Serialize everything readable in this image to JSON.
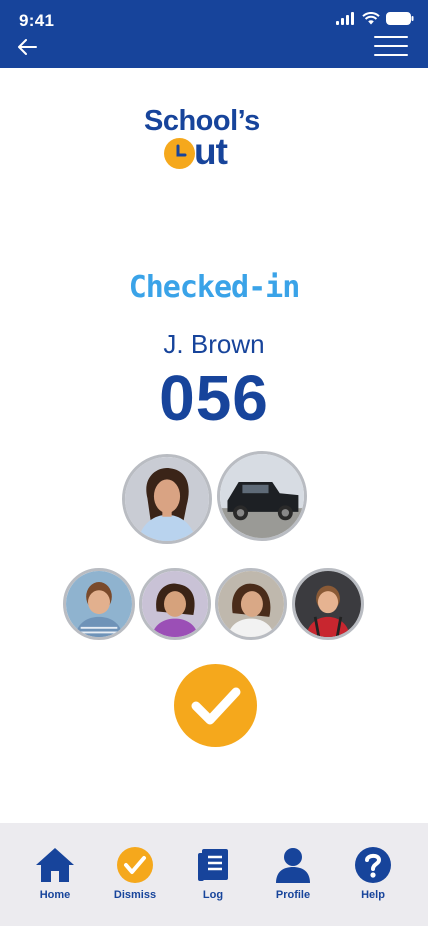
{
  "status_bar": {
    "time": "9:41"
  },
  "header": {
    "back_icon": "arrow-left-icon",
    "menu_icon": "hamburger-menu-icon",
    "color": "#17449b"
  },
  "logo": {
    "line1": "School’s",
    "line2": "ut",
    "clock_icon": "clock-icon",
    "accent": "#f5a81c"
  },
  "checkin": {
    "status": "Checked-in",
    "name": "J. Brown",
    "number": "056",
    "status_color": "#3aa3e8"
  },
  "guardian_photos": [
    {
      "name": "guardian-photo",
      "subject": "woman"
    },
    {
      "name": "vehicle-photo",
      "subject": "black pickup truck"
    }
  ],
  "student_photos": [
    {
      "subject": "boy"
    },
    {
      "subject": "girl"
    },
    {
      "subject": "girl"
    },
    {
      "subject": "boy in car seat"
    }
  ],
  "confirm": {
    "icon": "checkmark-icon",
    "color": "#f5a81c"
  },
  "nav": {
    "items": [
      {
        "label": "Home",
        "icon": "home-icon"
      },
      {
        "label": "Dismiss",
        "icon": "check-circle-icon"
      },
      {
        "label": "Log",
        "icon": "document-icon"
      },
      {
        "label": "Profile",
        "icon": "person-icon"
      },
      {
        "label": "Help",
        "icon": "question-icon"
      }
    ]
  }
}
